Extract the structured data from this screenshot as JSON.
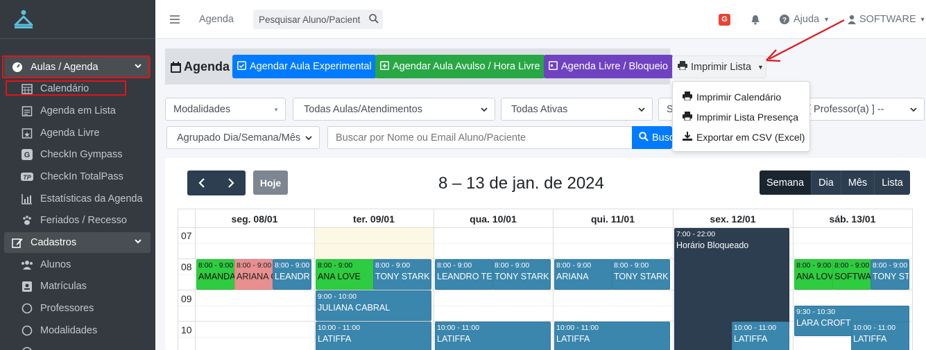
{
  "sidebar": {
    "items": [
      {
        "label": "Aulas / Agenda"
      },
      {
        "label": "Calendário"
      },
      {
        "label": "Agenda em Lista"
      },
      {
        "label": "Agenda Livre"
      },
      {
        "label": "CheckIn Gympass"
      },
      {
        "label": "CheckIn TotalPass"
      },
      {
        "label": "Estatísticas da Agenda"
      },
      {
        "label": "Feriados / Recesso"
      },
      {
        "label": "Cadastros"
      },
      {
        "label": "Alunos"
      },
      {
        "label": "Matrículas"
      },
      {
        "label": "Professores"
      },
      {
        "label": "Modalidades"
      }
    ]
  },
  "header": {
    "breadcrumb": "Agenda",
    "search_placeholder": "Pesquisar Aluno/Paciente",
    "g_badge": "G",
    "help": "Ajuda",
    "user": "SOFTWARE"
  },
  "toolbar": {
    "title": "Agenda",
    "btn_experimental": "Agendar Aula Experimental",
    "btn_avulso": "Agendar Aula Avulso / Hora Livre",
    "btn_livre": "Agenda Livre / Bloqueio",
    "btn_print": "Imprimir Lista"
  },
  "dropdown": {
    "items": [
      "Imprimir Calendário",
      "Imprimir Lista Presença",
      "Exportar em CSV (Excel)"
    ]
  },
  "filters": {
    "modalidades": "Modalidades",
    "aulas": "Todas Aulas/Atendimentos",
    "ativas": "Todas Ativas",
    "s_partial": "S",
    "professor": "[ Professor(a) ] --",
    "agrupado": "Agrupado Dia/Semana/Mês",
    "busca_placeholder": "Buscar por Nome ou Email Aluno/Paciente",
    "busca_btn": "Busc"
  },
  "calendar": {
    "today_btn": "Hoje",
    "title": "8 – 13 de jan. de 2024",
    "views": [
      "Semana",
      "Dia",
      "Mês",
      "Lista"
    ],
    "days": [
      "seg. 08/01",
      "ter. 09/01",
      "qua. 10/01",
      "qui. 11/01",
      "sex. 12/01",
      "sáb. 13/01"
    ],
    "hours": [
      "07",
      "08",
      "09",
      "10"
    ],
    "events": [
      {
        "time": "8:00 - 9:00",
        "name": "AMANDA"
      },
      {
        "time": "8:00 - 9:00",
        "name": "ARIANA G"
      },
      {
        "time": "8:00 - 9:00",
        "name": "LEANDR"
      },
      {
        "time": "8:00 - 9:00",
        "name": "ANA LOVE"
      },
      {
        "time": "8:00 - 9:00",
        "name": "TONY STARK"
      },
      {
        "time": "9:00 - 10:00",
        "name": "JULIANA CABRAL"
      },
      {
        "time": "10:00 - 11:00",
        "name": "LATIFFA"
      },
      {
        "time": "8:00 - 9:00",
        "name": "LEANDRO TESTE"
      },
      {
        "time": "8:00 - 9:00",
        "name": "TONY STARK"
      },
      {
        "time": "10:00 - 11:00",
        "name": "LATIFFA"
      },
      {
        "time": "8:00 - 9:00",
        "name": "ARIANA"
      },
      {
        "time": "8:00 - 9:00",
        "name": "TONY STARK"
      },
      {
        "time": "10:00 - 11:00",
        "name": "LATIFFA"
      },
      {
        "time": "7:00 - 22:00",
        "name": "Horário Bloqueado"
      },
      {
        "time": "10:00 - 11:00",
        "name": "LATIFFA"
      },
      {
        "time": "8:00 - 9:00",
        "name": "ANA LOVE"
      },
      {
        "time": "8:00 - 9:00",
        "name": "SOFTWARE"
      },
      {
        "time": "8:00 - 9:00",
        "name": "TONY STARK"
      },
      {
        "time": "9:30 - 10:30",
        "name": "LARA CROFT"
      },
      {
        "time": "10:00 - 11:00",
        "name": "LATIFFA"
      }
    ]
  },
  "colors": {
    "sidebar": "#343a40",
    "blue": "#007bff",
    "green": "#28a745",
    "purple": "#6f42c1",
    "dark": "#2c3e50",
    "highlight": "#e0151b"
  }
}
